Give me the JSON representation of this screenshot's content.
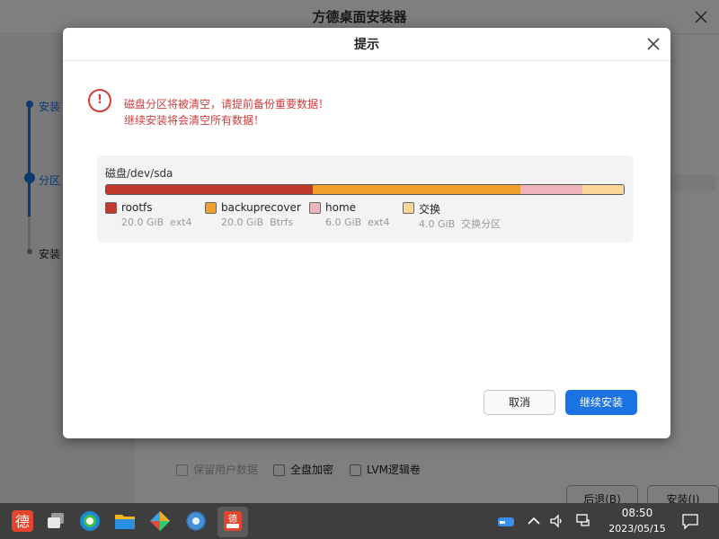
{
  "installer": {
    "title": "方德桌面安装器",
    "steps": [
      {
        "label": "安装",
        "state": "done"
      },
      {
        "label": "分区",
        "state": "current"
      },
      {
        "label": "安装",
        "state": "pending"
      }
    ],
    "options": [
      {
        "label": "保留用户数据",
        "checked": false,
        "disabled": true
      },
      {
        "label": "全盘加密",
        "checked": false,
        "disabled": false
      },
      {
        "label": "LVM逻辑卷",
        "checked": false,
        "disabled": false
      }
    ],
    "back_label": "后退(B)",
    "install_label": "安装(I)"
  },
  "dialog": {
    "title": "提示",
    "warning_lines": [
      "磁盘分区将被清空，请提前备份重要数据！",
      "继续安装将会清空所有数据！"
    ],
    "disk_label": "磁盘/dev/sda",
    "partitions": [
      {
        "name": "rootfs",
        "size": "20.0 GiB",
        "fs": "ext4",
        "size_gib": 20.0,
        "color": "#c0392b"
      },
      {
        "name": "backuprecover",
        "size": "20.0 GiB",
        "fs": "Btrfs",
        "size_gib": 20.0,
        "color": "#f0a02c"
      },
      {
        "name": "home",
        "size": "6.0 GiB",
        "fs": "ext4",
        "size_gib": 6.0,
        "color": "#eeb4bb"
      },
      {
        "name": "交换",
        "size": "4.0 GiB",
        "fs": "交换分区",
        "size_gib": 4.0,
        "color": "#fcd799"
      }
    ],
    "cancel_label": "取消",
    "continue_label": "继续安装"
  },
  "taskbar": {
    "time": "08:50",
    "date": "2023/05/15",
    "apps": [
      "start-menu-icon",
      "multitask-view-icon",
      "browser-icon",
      "file-manager-icon",
      "app-store-icon",
      "settings-icon",
      "installer-icon"
    ],
    "tray": [
      "drive-icon",
      "chevron-up-icon",
      "volume-icon",
      "network-icon"
    ],
    "accent": "#1a72e3"
  }
}
